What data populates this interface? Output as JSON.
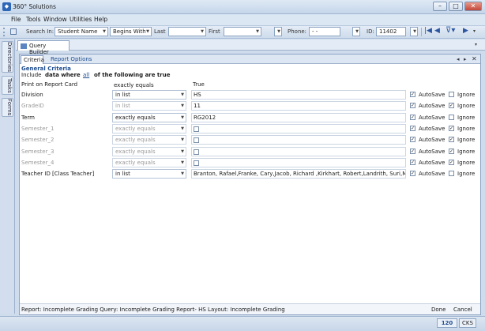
{
  "window": {
    "title": "360° Solutions"
  },
  "menu": [
    "File",
    "Tools",
    "Window",
    "Utilities",
    "Help"
  ],
  "toolbar": {
    "search_label": "Search In:",
    "search_value": "Student Name",
    "match_value": "Begins With",
    "last_label": "Last",
    "first_label": "First",
    "phone_label": "Phone:",
    "phone_value": "-  -",
    "id_label": "ID:",
    "id_value": "11402"
  },
  "sidebar_tabs": [
    "Directories",
    "Tasks",
    "Forms"
  ],
  "doc_tab": "Query Builder",
  "tabs": {
    "criteria": "Criteria",
    "report_options": "Report Options"
  },
  "general": {
    "title": "General Criteria",
    "include": "Include",
    "data_where": "data where",
    "all": "all",
    "following": "of the following are true"
  },
  "print_row": {
    "label": "Print on Report Card",
    "operator": "exactly equals",
    "value": "True"
  },
  "criteria": [
    {
      "label": "Division",
      "operator": "in list",
      "value": "HS",
      "enabled": true,
      "autosave": true,
      "ignore": false,
      "autosave_label": "AutoSave",
      "ignore_label": "Ignore"
    },
    {
      "label": "GradeID",
      "operator": "in list",
      "value": "11",
      "enabled": false,
      "autosave": true,
      "ignore": true,
      "autosave_label": "AutoSave",
      "ignore_label": "Ignore"
    },
    {
      "label": "Term",
      "operator": "exactly equals",
      "value": "RG2012",
      "enabled": true,
      "autosave": true,
      "ignore": false,
      "autosave_label": "AutoSave",
      "ignore_label": "Ignore"
    },
    {
      "label": "Semester_1",
      "operator": "exactly equals",
      "value": "",
      "enabled": false,
      "autosave": true,
      "ignore": true,
      "autosave_label": "AutoSave",
      "ignore_label": "Ignore"
    },
    {
      "label": "Semester_2",
      "operator": "exactly equals",
      "value": "",
      "enabled": false,
      "autosave": true,
      "ignore": true,
      "autosave_label": "AutoSave",
      "ignore_label": "Ignore"
    },
    {
      "label": "Semester_3",
      "operator": "exactly equals",
      "value": "",
      "enabled": false,
      "autosave": true,
      "ignore": true,
      "autosave_label": "AutoSave",
      "ignore_label": "Ignore"
    },
    {
      "label": "Semester_4",
      "operator": "exactly equals",
      "value": "",
      "enabled": false,
      "autosave": true,
      "ignore": true,
      "autosave_label": "AutoSave",
      "ignore_label": "Ignore"
    },
    {
      "label": "Teacher ID [Class Teacher]",
      "operator": "in list",
      "value": "Branton, Rafael,Franke, Cary,Jacob, Richard ,Kirkhart, Robert,Landrith, Suri,Maynerich,",
      "enabled": true,
      "autosave": true,
      "ignore": false,
      "autosave_label": "AutoSave",
      "ignore_label": "Ignore"
    }
  ],
  "status": {
    "text": "Report: Incomplete Grading  Query: Incomplete Grading Report- HS  Layout: Incomplete Grading",
    "done": "Done",
    "cancel": "Cancel"
  },
  "bottom": {
    "count": "120",
    "mode": "CKS"
  }
}
